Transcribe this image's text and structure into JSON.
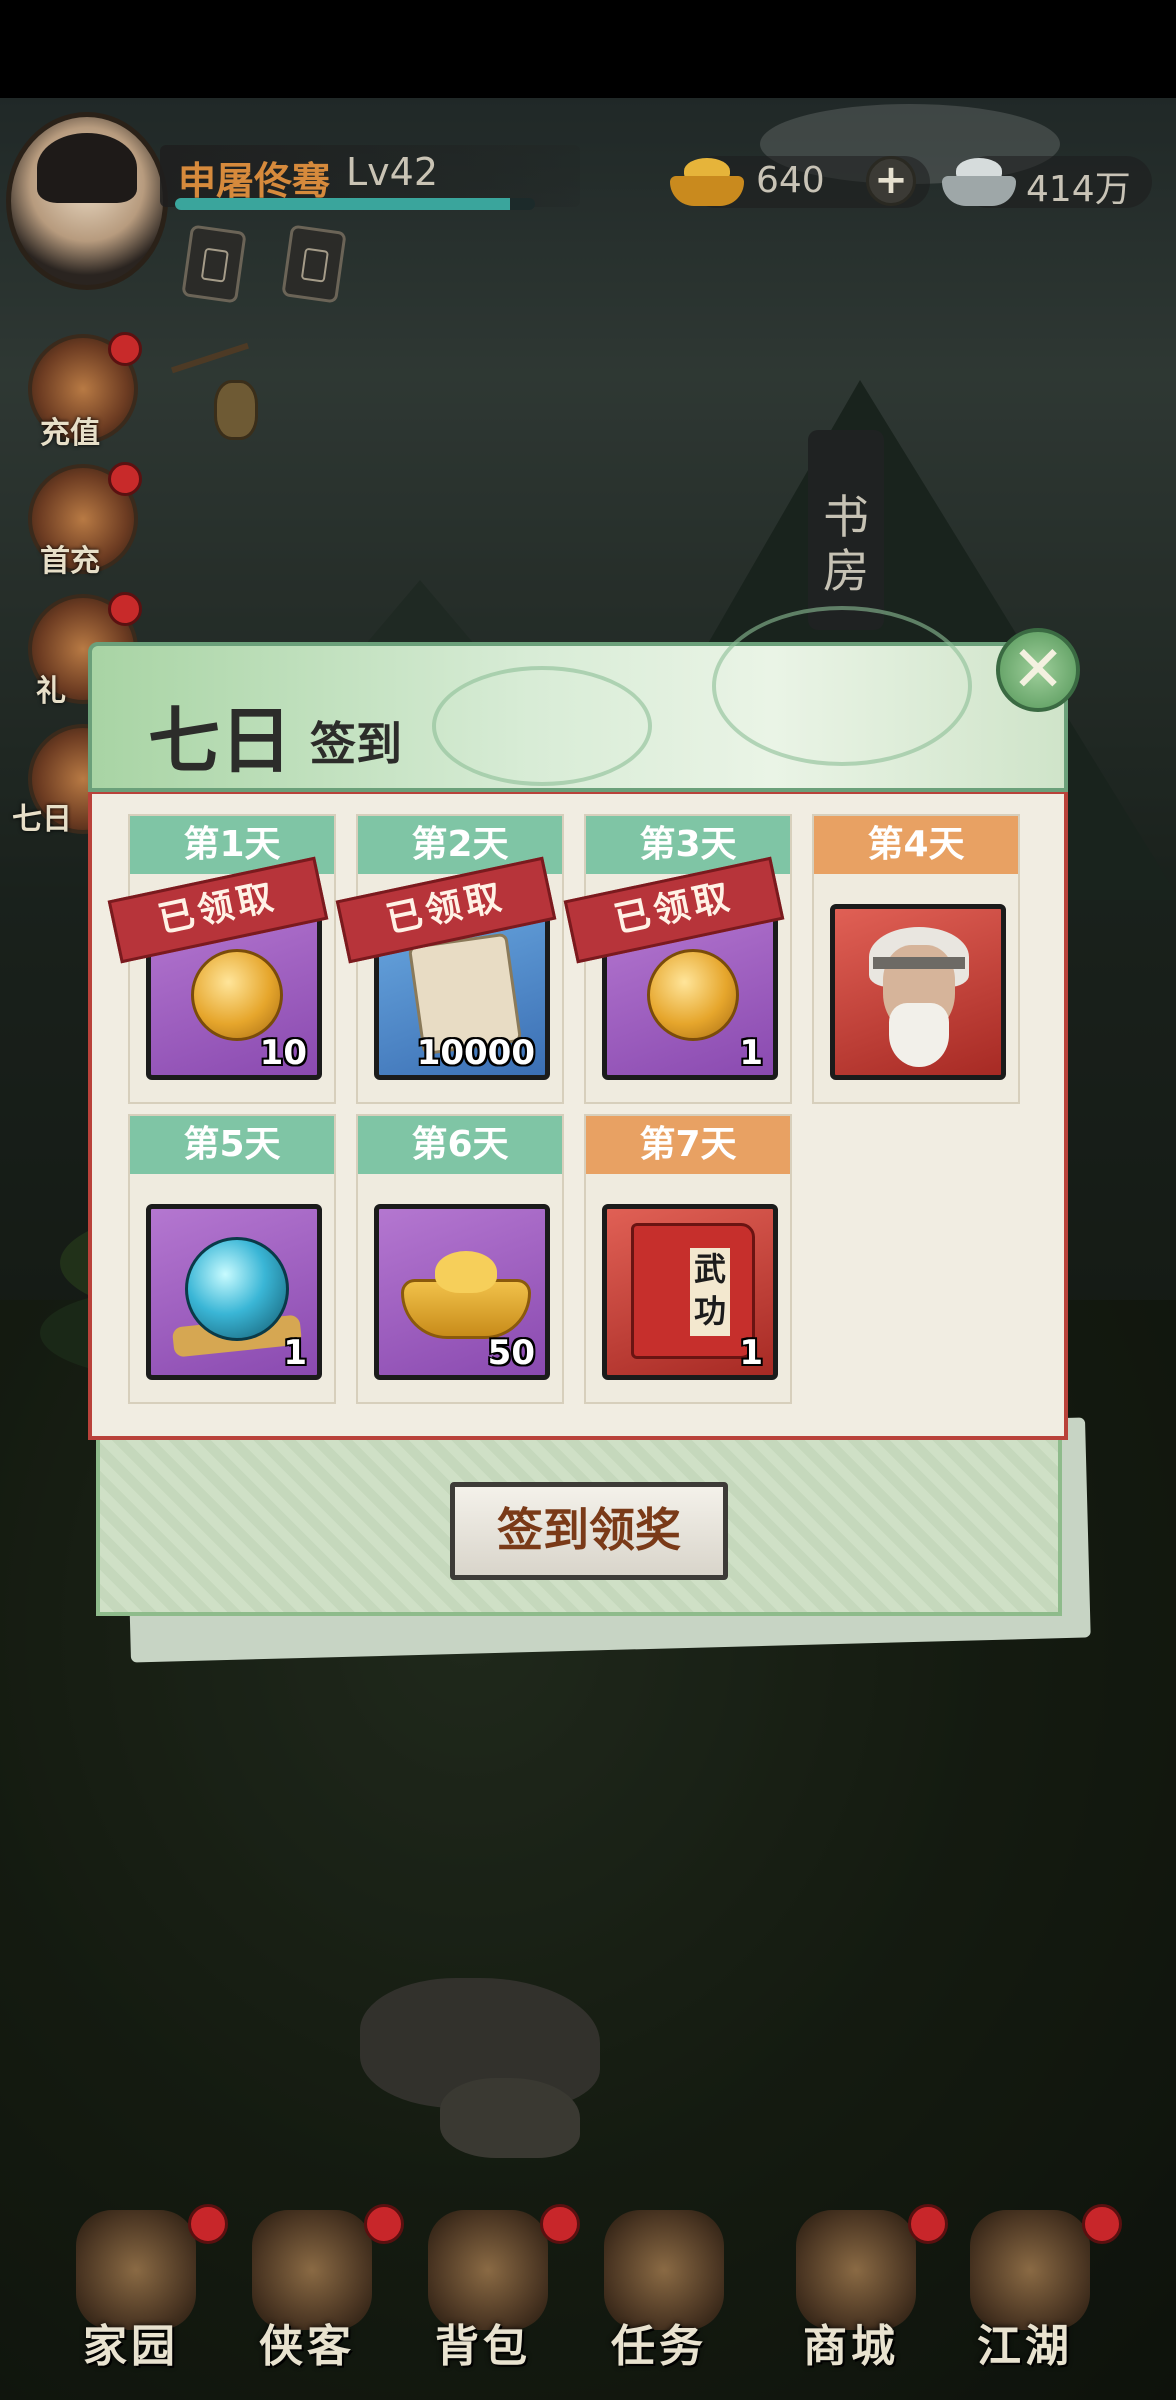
{
  "player": {
    "name": "申屠佟骞",
    "level": "Lv42",
    "exp_fraction": 0.93
  },
  "currency": {
    "gold": "640",
    "silver": "414万"
  },
  "side_menu": [
    {
      "label": "充值"
    },
    {
      "label": "首充"
    },
    {
      "label": "礼"
    },
    {
      "label": "七日"
    }
  ],
  "scene": {
    "study_label": "书房"
  },
  "modal": {
    "title_main": "七日",
    "title_sub": "签到",
    "claim_button": "签到领奖",
    "claimed_stamp": "已领取",
    "days": [
      {
        "label": "第1天",
        "count": "10",
        "claimed": true,
        "item": "gold-coin",
        "frame": "purple",
        "head": "green"
      },
      {
        "label": "第2天",
        "count": "10000",
        "claimed": true,
        "item": "scroll",
        "frame": "blue",
        "head": "green"
      },
      {
        "label": "第3天",
        "count": "1",
        "claimed": true,
        "item": "gold-coin",
        "frame": "purple",
        "head": "green"
      },
      {
        "label": "第4天",
        "count": "",
        "claimed": false,
        "item": "elder-portrait",
        "frame": "red",
        "head": "orange"
      },
      {
        "label": "第5天",
        "count": "1",
        "claimed": false,
        "item": "spirit-orb",
        "frame": "purple",
        "head": "green"
      },
      {
        "label": "第6天",
        "count": "50",
        "claimed": false,
        "item": "gold-ingot",
        "frame": "purple",
        "head": "green"
      },
      {
        "label": "第7天",
        "count": "1",
        "claimed": false,
        "item": "martial-book",
        "frame": "red",
        "head": "orange"
      }
    ],
    "book_text": "武功"
  },
  "bottom_nav": [
    {
      "label": "家园"
    },
    {
      "label": "侠客"
    },
    {
      "label": "背包"
    },
    {
      "label": "任务"
    },
    {
      "label": "商城"
    },
    {
      "label": "江湖"
    }
  ],
  "colors": {
    "head_green": "#7fc5a5",
    "head_orange": "#e8a163",
    "stamp_red": "#b7343a",
    "name_orange": "#d68a3c"
  }
}
